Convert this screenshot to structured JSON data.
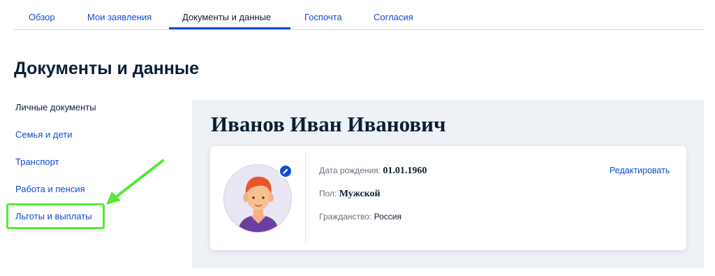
{
  "tabs": [
    {
      "label": "Обзор",
      "active": false
    },
    {
      "label": "Мои заявления",
      "active": false
    },
    {
      "label": "Документы и данные",
      "active": true
    },
    {
      "label": "Госпочта",
      "active": false
    },
    {
      "label": "Согласия",
      "active": false
    }
  ],
  "page": {
    "title": "Документы и данные"
  },
  "sidebar": {
    "items": [
      {
        "label": "Личные документы",
        "current": true
      },
      {
        "label": "Семья и дети"
      },
      {
        "label": "Транспорт"
      },
      {
        "label": "Работа и пенсия"
      },
      {
        "label": "Льготы и выплаты",
        "highlighted": true
      }
    ]
  },
  "profile": {
    "full_name": "Иванов Иван Иванович",
    "fields": [
      {
        "label": "Дата рождения:",
        "value": "01.01.1960"
      },
      {
        "label": "Пол:",
        "value": "Мужской"
      },
      {
        "label": "Гражданство:",
        "value": "Россия"
      }
    ],
    "edit_label": "Редактировать",
    "avatar_icon": "user-avatar-icon",
    "edit_badge_icon": "pencil-icon"
  },
  "annotation": {
    "highlight_color": "#58e83a",
    "arrow_color": "#58e83a"
  },
  "colors": {
    "accent": "#0d4cd3",
    "text": "#0b1f33",
    "panel": "#eef1f6"
  }
}
